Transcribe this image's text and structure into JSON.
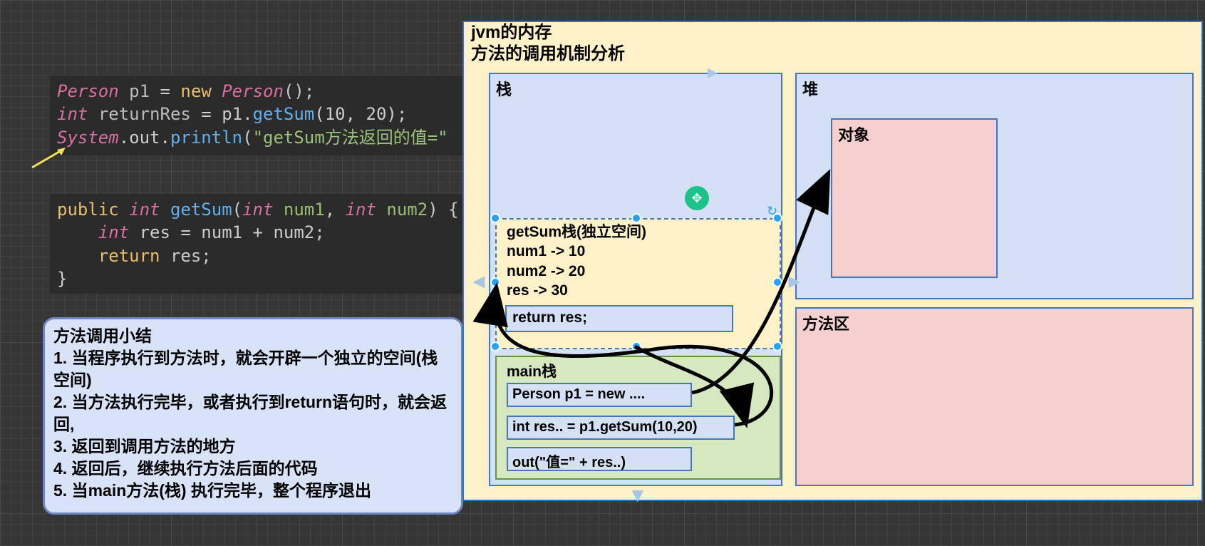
{
  "code1": {
    "line1_type": "Person",
    "line1_var": "p1",
    "line1_eq": " = ",
    "line1_new": "new",
    "line1_ctor": " Person",
    "line1_tail": "();",
    "line2_type": "int",
    "line2_var": "returnRes",
    "line2_eq": " = p1.",
    "line2_method": "getSum",
    "line2_args": "(10, 20);",
    "line3_sys": "System",
    "line3_out": ".out.",
    "line3_println": "println",
    "line3_open": "(",
    "line3_str": "\"getSum方法返回的值=\""
  },
  "code2": {
    "l1_public": "public",
    "l1_int": " int ",
    "l1_name": "getSum",
    "l1_open": "(",
    "l1_t1": "int ",
    "l1_p1": "num1",
    "l1_c": ", ",
    "l1_t2": "int ",
    "l1_p2": "num2",
    "l1_close": ") {",
    "l2": "    int res = num1 + num2;",
    "l3_ret": "    return",
    "l3_rest": " res;",
    "l4": "}"
  },
  "summary": {
    "title": "方法调用小结",
    "i1": "1. 当程序执行到方法时，就会开辟一个独立的空间(栈空间)",
    "i2": "2. 当方法执行完毕，或者执行到return语句时，就会返回,",
    "i3": "3. 返回到调用方法的地方",
    "i4": "4. 返回后，继续执行方法后面的代码",
    "i5": "5. 当main方法(栈) 执行完毕，整个程序退出"
  },
  "jvm": {
    "title1": "jvm的内存",
    "title2": "方法的调用机制分析",
    "stack_label": "栈",
    "heap_label": "堆",
    "object_label": "对象",
    "method_area_label": "方法区",
    "getsum": {
      "title": "getSum栈(独立空间)",
      "num1": "num1 -> 10",
      "num2": "num2 -> 20",
      "res": "res -> 30",
      "ret": "return res;"
    },
    "main": {
      "title": "main栈",
      "l1": "Person p1 = new ....",
      "l2": "int res.. = p1.getSum(10,20)",
      "l3": "out(\"值=\" + res..)"
    }
  }
}
